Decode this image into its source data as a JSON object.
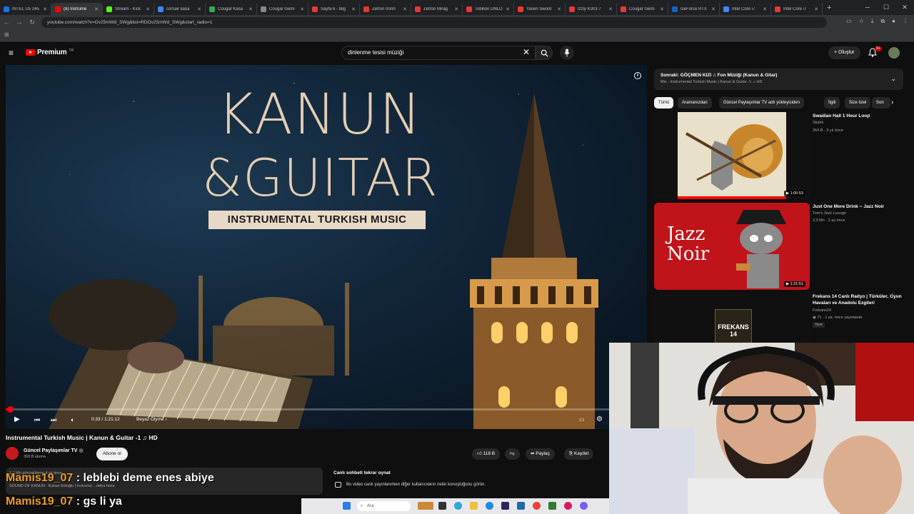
{
  "browser": {
    "tabs": [
      {
        "label": "INTEL U5 245",
        "color": "#1a73e8"
      },
      {
        "label": "(8) Instrume",
        "color": "#ff0000",
        "active": true
      },
      {
        "label": "Stream - Kick",
        "color": "#53fc18"
      },
      {
        "label": "corsair kasa",
        "color": "#4285f4"
      },
      {
        "label": "Cougar Kasa",
        "color": "#34a853"
      },
      {
        "label": "Cougar Gemi",
        "color": "#888888"
      },
      {
        "label": "Sayfa 6 - bilg",
        "color": "#e53935"
      },
      {
        "label": "Zetron Ironh",
        "color": "#e53935"
      },
      {
        "label": "Zetron Mirag",
        "color": "#e53935"
      },
      {
        "label": "Tobilion UNLO",
        "color": "#e53935"
      },
      {
        "label": "Yasen Sword",
        "color": "#e53935"
      },
      {
        "label": "Izzly K303 7",
        "color": "#e53935"
      },
      {
        "label": "Cougar Gemi",
        "color": "#e53935"
      },
      {
        "label": "GeForce RTX",
        "color": "#1565c0"
      },
      {
        "label": "Intel Core i7",
        "color": "#4285f4"
      },
      {
        "label": "Intel Core i7",
        "color": "#e53935"
      }
    ],
    "url": "youtube.com/watch?v=Ov25mWd_SWg&list=RDOv25mWd_SWg&start_radio=1"
  },
  "header": {
    "logo_text": "Premium",
    "logo_sup": "TR",
    "search_value": "dinlenme tesisi müziği",
    "create_label": "Oluştur",
    "notif_count": "9+"
  },
  "player": {
    "title_line1": "KANUN",
    "title_line2": "&GUITAR",
    "subtitle": "INSTRUMENTAL TURKISH MUSIC",
    "time": "0:33 / 1:21:12",
    "chapter": "Beyaz Ölyme",
    "progress": 0.0068
  },
  "video": {
    "title": "Instrumental Turkish Music | Kanun & Guitar -1 ♫ HD",
    "channel": "Güncel Paylaşımlar TV",
    "subs": "368 B abone",
    "subscribe": "Abone ol",
    "likes": "118 B",
    "share": "Paylaş",
    "save": "Kaydet",
    "desc_line1": "1,1 Mn görüntüleme 4 yıl önce",
    "desc_line2": "SOUND OF KANUN - Kutsal Sütoğlu | Instrume",
    "desc_more": "...daha fazla"
  },
  "livechat": {
    "title": "Canlı sohbeti tekrar oynat",
    "info": "Bu video canlı yayınlanırken diğer kullanıcıların neler konuştuğunu görün."
  },
  "upnext": {
    "title": "Sonraki: GÖÇMEN KIZI ♫ Fon Müziği (Kanun & Gitar)",
    "sub": "Mix - Instrumental Turkish Music | Kanun & Guitar -1 ♫ HD"
  },
  "chips": [
    "Tümü",
    "Aramanızdan",
    "Güncel Paylaşımlar TV adlı yükleyiciden",
    "İlgili",
    "Size özel",
    "Son"
  ],
  "recommendations": [
    {
      "title": "Swadian Hall 1 Hour Loop",
      "channel": "Skalm",
      "meta": "264 B · 3 yıl önce",
      "duration": "1:00:53"
    },
    {
      "title": "Just One More Drink -- Jazz Noir",
      "channel": "Tom's Jazz Lounge",
      "meta": "3,3 Mn · 2 ay önce",
      "duration": "1:21:51",
      "thumb_text": "Jazz Noir"
    },
    {
      "title": "Frekans 14 Canlı Radyo | Türküler, Oyun Havaları ve Anadolu Ezgileri",
      "channel": "Frekans14",
      "meta": "71 · 1 sa. önce yayınlandı",
      "badge": "Yeni",
      "thumb_text": "FREKANS 14"
    }
  ],
  "overlay": {
    "msg1_user": "Mamis19_07",
    "msg1_text": " : leblebi deme enes abiye",
    "msg2_user": "Mamis19_07",
    "msg2_text": " : gs li ya"
  },
  "taskbar": {
    "search_label": "Ara"
  }
}
